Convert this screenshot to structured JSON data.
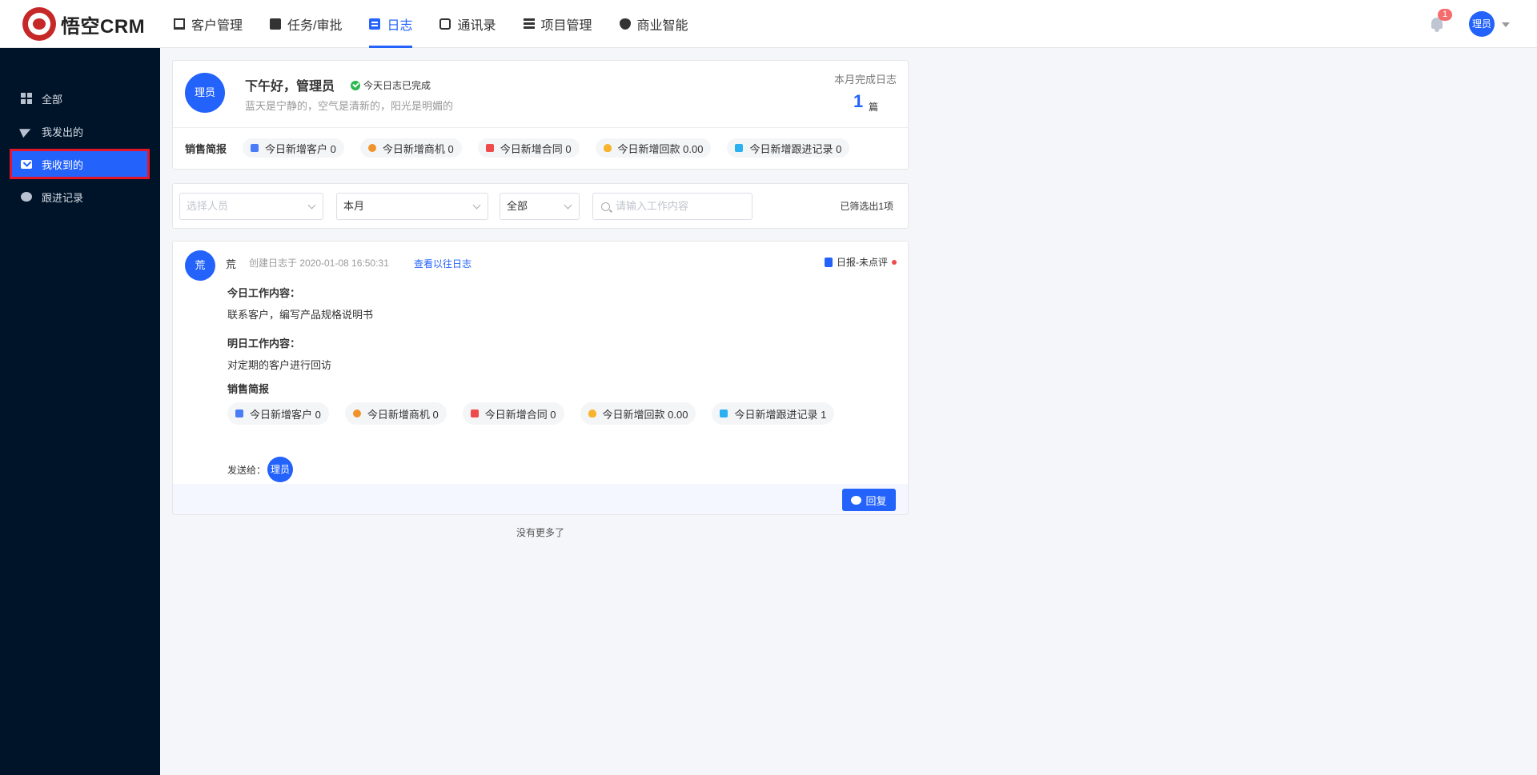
{
  "app": {
    "logo_text": "悟空CRM",
    "accent_color": "#2362fb",
    "sidebar_color": "#001429"
  },
  "nav": {
    "items": [
      {
        "label": "客户管理",
        "icon": "building-icon"
      },
      {
        "label": "任务/审批",
        "icon": "briefcase-icon"
      },
      {
        "label": "日志",
        "icon": "document-icon",
        "active": true
      },
      {
        "label": "通讯录",
        "icon": "phone-book-icon"
      },
      {
        "label": "项目管理",
        "icon": "list-icon"
      },
      {
        "label": "商业智能",
        "icon": "shield-icon"
      }
    ]
  },
  "header": {
    "notification_count": "1",
    "user_avatar": "理员"
  },
  "sidebar": {
    "items": [
      {
        "label": "全部",
        "icon": "grid-icon"
      },
      {
        "label": "我发出的",
        "icon": "send-icon"
      },
      {
        "label": "我收到的",
        "icon": "mail-icon",
        "active": true
      },
      {
        "label": "跟进记录",
        "icon": "chat-icon"
      }
    ]
  },
  "summary": {
    "avatar": "理员",
    "greeting": "下午好，管理员",
    "status": "今天日志已完成",
    "motto": "蓝天是宁静的，空气是清新的，阳光是明媚的",
    "month_label": "本月完成日志",
    "month_count": "1",
    "month_unit": "篇",
    "stats_title": "销售简报",
    "stats": [
      "今日新增客户 0",
      "今日新增商机 0",
      "今日新增合同 0",
      "今日新增回款 0.00",
      "今日新增跟进记录 0"
    ]
  },
  "filter": {
    "person_placeholder": "选择人员",
    "period": "本月",
    "type": "全部",
    "search_placeholder": "请输入工作内容",
    "count_text": "已筛选出1项"
  },
  "log": {
    "avatar": "荒",
    "author": "荒",
    "created": "创建日志于 2020-01-08 16:50:31",
    "history_link": "查看以往日志",
    "type": "日报-未点评",
    "today_title": "今日工作内容：",
    "today_content": "联系客户，编写产品规格说明书",
    "tomorrow_title": "明日工作内容：",
    "tomorrow_content": "对定期的客户进行回访",
    "stats_title": "销售简报",
    "stats": [
      "今日新增客户 0",
      "今日新增商机 0",
      "今日新增合同 0",
      "今日新增回款 0.00",
      "今日新增跟进记录 1"
    ],
    "sendto_label": "发送给：",
    "sendto_avatar": "理员",
    "reply_label": "回复"
  },
  "footer": {
    "no_more": "没有更多了"
  }
}
